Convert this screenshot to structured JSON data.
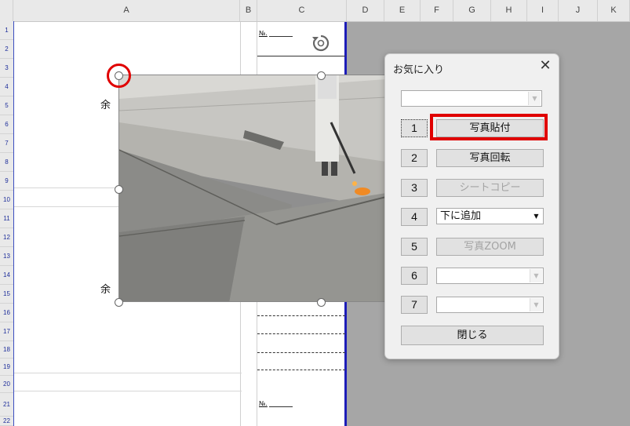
{
  "columns": [
    "A",
    "B",
    "C",
    "D",
    "E",
    "F",
    "G",
    "H",
    "I",
    "J",
    "K"
  ],
  "rows": [
    "1",
    "2",
    "3",
    "4",
    "5",
    "6",
    "7",
    "8",
    "9",
    "10",
    "11",
    "12",
    "13",
    "14",
    "15",
    "16",
    "17",
    "18",
    "19",
    "20",
    "21",
    "22"
  ],
  "sheet": {
    "cell_a4": "余",
    "cell_a15": "余",
    "cell_c1": "№.",
    "cell_c21": "№."
  },
  "dialog": {
    "title": "お気に入り",
    "close_label": "✕",
    "top_combo_value": "",
    "items": [
      {
        "number": "1",
        "label": "写真貼付",
        "type": "button",
        "enabled": true
      },
      {
        "number": "2",
        "label": "写真回転",
        "type": "button",
        "enabled": true
      },
      {
        "number": "3",
        "label": "シートコピー",
        "type": "button",
        "enabled": false
      },
      {
        "number": "4",
        "label": "下に追加",
        "type": "combo",
        "enabled": true
      },
      {
        "number": "5",
        "label": "写真ZOOM",
        "type": "button",
        "enabled": false
      },
      {
        "number": "6",
        "label": "",
        "type": "combo",
        "enabled": false
      },
      {
        "number": "7",
        "label": "",
        "type": "combo",
        "enabled": false
      }
    ],
    "close_button_label": "閉じる"
  },
  "highlight_color": "#e00000",
  "selection_border_color": "#1d1db8",
  "icons": [
    "rotate-handle-icon",
    "dropdown-arrow-icon",
    "close-icon"
  ]
}
